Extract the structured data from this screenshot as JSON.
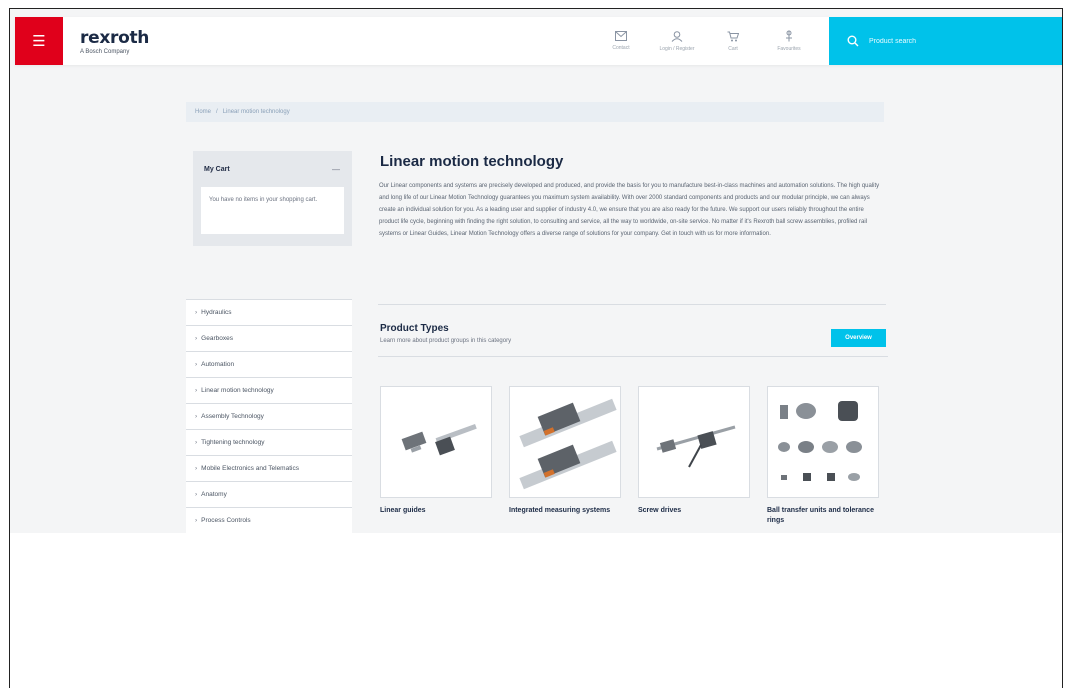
{
  "header": {
    "brand": "rexroth",
    "brand_sub": "A Bosch Company",
    "icons": [
      {
        "label": "Contact",
        "icon": "envelope-icon"
      },
      {
        "label": "Login / Register",
        "icon": "user-icon"
      },
      {
        "label": "Cart",
        "icon": "cart-icon"
      },
      {
        "label": "Favourites",
        "icon": "pin-icon"
      }
    ],
    "search_placeholder": "Product search"
  },
  "breadcrumb": [
    "Home",
    "Linear motion technology"
  ],
  "cart": {
    "title": "My Cart",
    "body": "You have no items in your shopping cart."
  },
  "sidenav": [
    "Hydraulics",
    "Gearboxes",
    "Automation",
    "Linear motion technology",
    "Assembly Technology",
    "Tightening technology",
    "Mobile Electronics and Telematics",
    "Anatomy",
    "Process Controls"
  ],
  "main": {
    "title": "Linear motion technology",
    "intro": "Our Linear components and systems are precisely developed and produced, and provide the basis for you to manufacture best-in-class machines and automation solutions. The high quality and long life of our Linear Motion Technology guarantees you maximum system availability. With over 2000 standard components and products and our modular principle, we can always create an individual solution for you. As a leading user and supplier of industry 4.0, we ensure that you are also ready for the future. We support our users reliably throughout the entire product life cycle, beginning with finding the right solution, to consulting and service, all the way to worldwide, on-site service. No matter if it's Rexroth ball screw assemblies, profiled rail systems or Linear Guides, Linear Motion Technology offers a diverse range of solutions for your company. Get in touch with us for more information.",
    "product_types": {
      "title": "Product Types",
      "subtitle": "Learn more about product groups in this category",
      "button": "Overview",
      "cards": [
        {
          "name": "Linear guides"
        },
        {
          "name": "Integrated measuring systems"
        },
        {
          "name": "Screw drives"
        },
        {
          "name": "Ball transfer units and tolerance rings"
        }
      ]
    }
  },
  "colors": {
    "brand_red": "#e0001b",
    "accent_cyan": "#00c2ea",
    "navy": "#1b2a45"
  }
}
